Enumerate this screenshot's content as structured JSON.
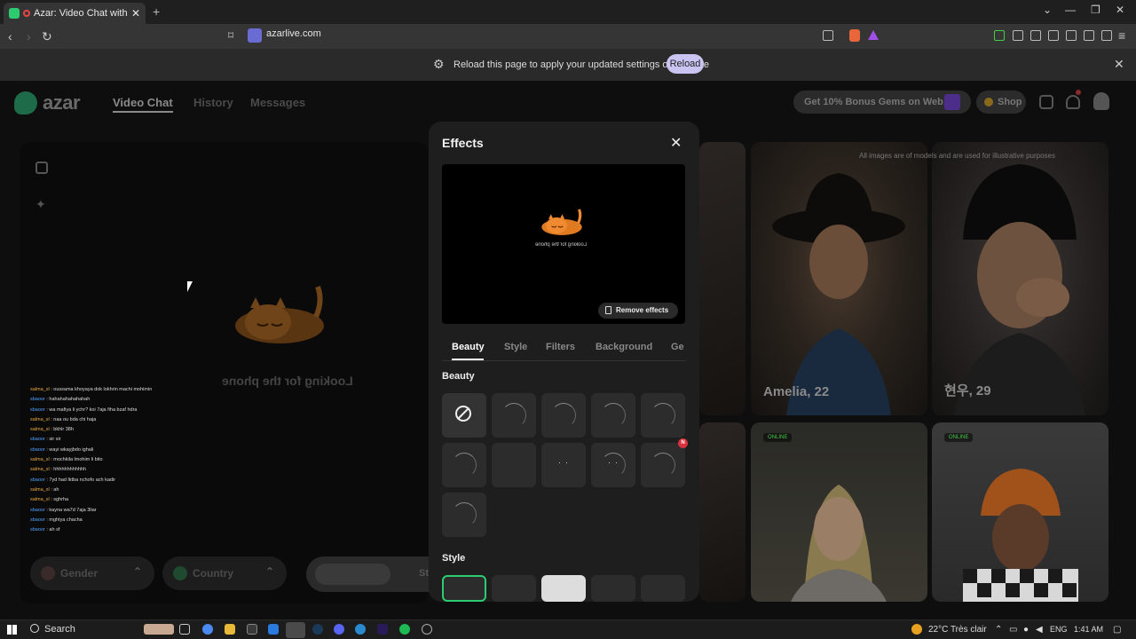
{
  "browser": {
    "tab_title": "Azar: Video Chat with New P",
    "new_tab": "+",
    "url": "azarlive.com",
    "notice": "Reload this page to apply your updated settings on this site",
    "reload_label": "Reload"
  },
  "header": {
    "logo": "azar",
    "nav": [
      "Video Chat",
      "History",
      "Messages"
    ],
    "bonus": "Get 10% Bonus Gems on Web!",
    "shop": "Shop"
  },
  "left": {
    "status": "Looking for the phone",
    "chat": [
      {
        "user": "salma_sl",
        "text": "oussama khoyaya dok lokhrin machi mohimin",
        "kind": "u2"
      },
      {
        "user": "sbaoor",
        "text": "hahahahahahahah",
        "kind": "u1"
      },
      {
        "user": "sbaoor",
        "text": "wa mafiya li ychr? koi 7aja fiha bzaf hdra",
        "kind": "u1"
      },
      {
        "user": "salma_sl",
        "text": "naa ou bda chi haja",
        "kind": "u2"
      },
      {
        "user": "salma_sl",
        "text": "bkhlr 38h",
        "kind": "u2"
      },
      {
        "user": "sbaoor",
        "text": "sir sir",
        "kind": "u1"
      },
      {
        "user": "sbaoor",
        "text": "wayi wkayjbdo ighali",
        "kind": "u1"
      },
      {
        "user": "salma_sl",
        "text": "mochkila lmohim li bito",
        "kind": "u2"
      },
      {
        "user": "salma_sl",
        "text": "hhhhhhhhhhhh",
        "kind": "u2"
      },
      {
        "user": "sbaoor",
        "text": "7yd had lktba nchofo ach kadir",
        "kind": "u1"
      },
      {
        "user": "salma_sl",
        "text": "ah",
        "kind": "u2"
      },
      {
        "user": "salma_sl",
        "text": "sghrha",
        "kind": "u2"
      },
      {
        "user": "sbaoor",
        "text": "kayna wa7d 7aja 3liar",
        "kind": "u1"
      },
      {
        "user": "sbaoor",
        "text": "mghtya chacha",
        "kind": "u1"
      },
      {
        "user": "sbaoor",
        "text": "ah sf",
        "kind": "u1"
      }
    ],
    "gender": "Gender",
    "country": "Country",
    "start": "St"
  },
  "grid": {
    "disclaimer": "All images are of models and are used for illustrative purposes",
    "profiles": [
      {
        "caption": "Amelia, 22"
      },
      {
        "caption": "현우, 29"
      }
    ],
    "online": "ONLINE"
  },
  "modal": {
    "title": "Effects",
    "preview_status": "Looking for the phone",
    "remove": "Remove effects",
    "tabs": [
      "Beauty",
      "Style",
      "Filters",
      "Background",
      "Ge"
    ],
    "section_beauty": "Beauty",
    "section_style": "Style",
    "new_badge": "N"
  },
  "taskbar": {
    "search": "Search",
    "weather": "22°C  Très clair",
    "lang": "ENG",
    "time": "1:41 AM"
  },
  "colors": {
    "accent": "#2ecc71",
    "reload": "#c9c4f2",
    "badge": "#d9323f"
  }
}
